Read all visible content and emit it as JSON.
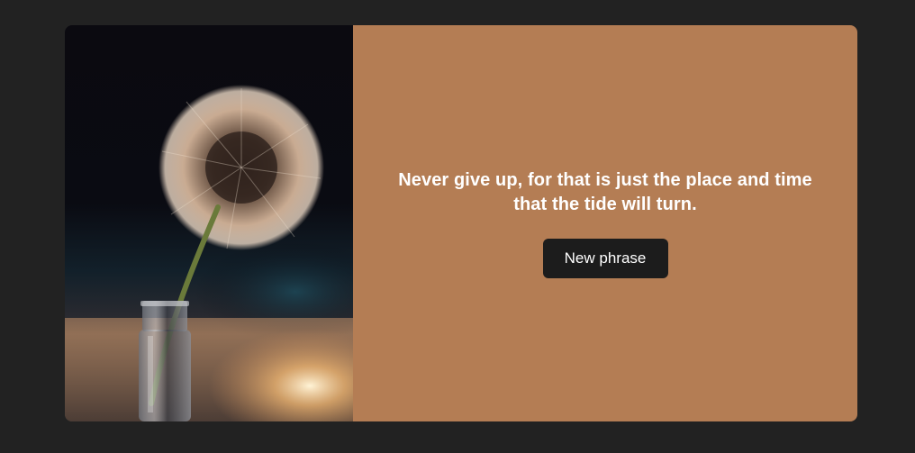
{
  "quote": {
    "text": "Never give up, for that is just the place and time that the tide will turn."
  },
  "actions": {
    "new_phrase_label": "New phrase"
  },
  "colors": {
    "page_background": "#222222",
    "content_background": "#b47d54",
    "button_background": "#1c1c1c",
    "text": "#ffffff"
  }
}
